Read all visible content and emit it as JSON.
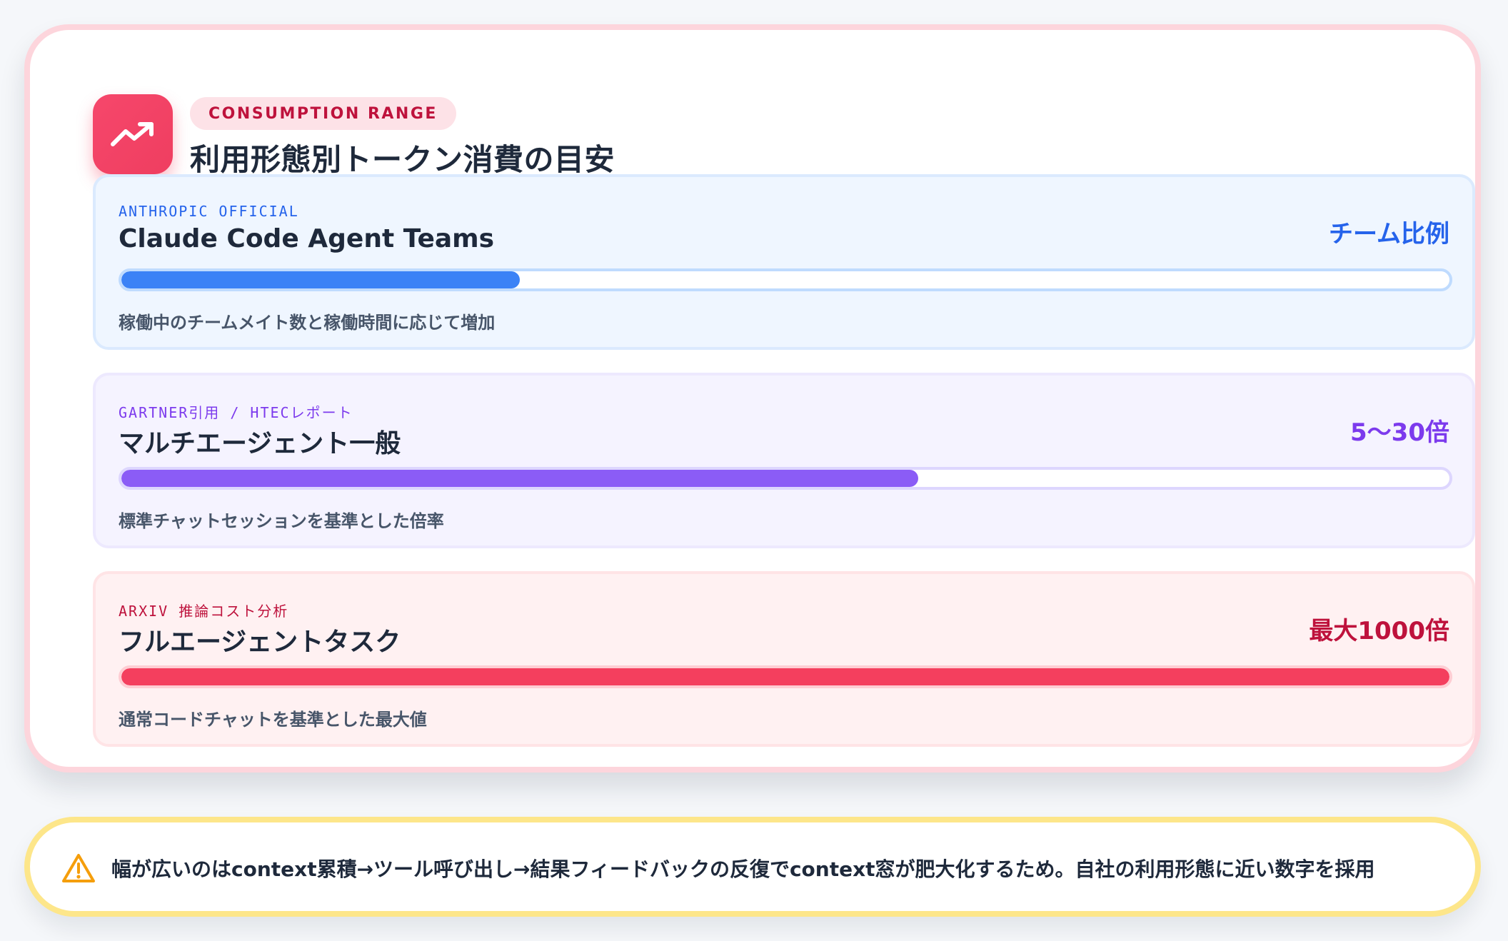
{
  "header": {
    "badge": "CONSUMPTION RANGE",
    "title": "利用形態別トークン消費の目安",
    "icon": "trending-up-icon",
    "accent_color": "#f43f5e"
  },
  "rows": [
    {
      "source": "ANTHROPIC OFFICIAL",
      "name": "Claude Code Agent Teams",
      "value": "チーム比例",
      "description": "稼働中のチームメイト数と稼働時間に応じて増加",
      "level": 0.3,
      "colors": {
        "accent": "#2563eb",
        "fill": "#3b82f6",
        "background": "#eff6ff",
        "border": "#dbeafe",
        "track_border": "#bfdbfe"
      }
    },
    {
      "source": "GARTNER引用 / HTECレポート",
      "name": "マルチエージェント一般",
      "value": "5〜30倍",
      "description": "標準チャットセッションを基準とした倍率",
      "level": 0.6,
      "colors": {
        "accent": "#7c3aed",
        "fill": "#8b5cf6",
        "background": "#f5f3ff",
        "border": "#ede9fe",
        "track_border": "#ddd6fe"
      }
    },
    {
      "source": "ARXIV 推論コスト分析",
      "name": "フルエージェントタスク",
      "value": "最大1000倍",
      "description": "通常コードチャットを基準とした最大値",
      "level": 1.0,
      "colors": {
        "accent": "#be123c",
        "fill": "#f43f5e",
        "background": "#fff1f2",
        "border": "#ffe4e6",
        "track_border": "#fecdd3"
      }
    }
  ],
  "note": {
    "icon": "warning-icon",
    "text": "幅が広いのはcontext累積→ツール呼び出し→結果フィードバックの反復でcontext窓が肥大化するため。自社の利用形態に近い数字を採用"
  }
}
